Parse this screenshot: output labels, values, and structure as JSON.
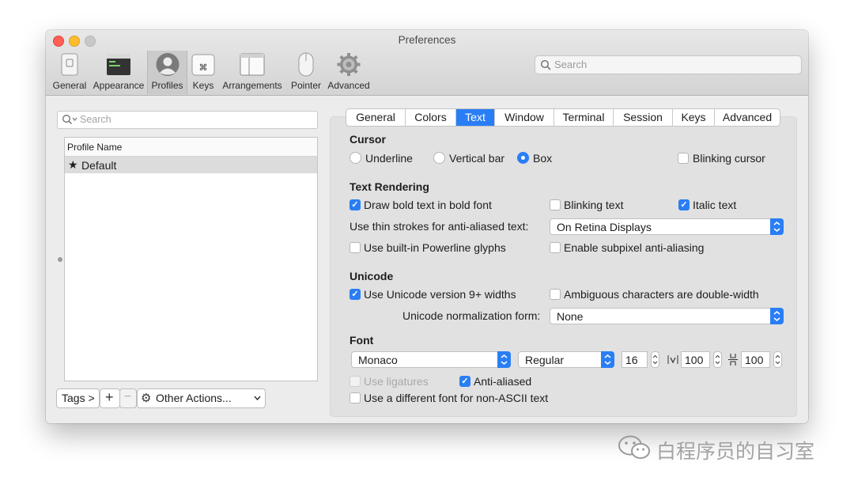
{
  "window": {
    "title": "Preferences"
  },
  "colors": {
    "accent": "#2a7ef5",
    "close": "#fe5f57",
    "minimize": "#febc2e",
    "zoom": "#c8c8c8"
  },
  "toolbar": {
    "items": [
      {
        "label": "General",
        "icon": "general-icon"
      },
      {
        "label": "Appearance",
        "icon": "appearance-icon"
      },
      {
        "label": "Profiles",
        "icon": "profiles-icon",
        "selected": true
      },
      {
        "label": "Keys",
        "icon": "keys-icon"
      },
      {
        "label": "Arrangements",
        "icon": "arrangements-icon"
      },
      {
        "label": "Pointer",
        "icon": "pointer-icon"
      },
      {
        "label": "Advanced",
        "icon": "advanced-gear-icon"
      }
    ],
    "search_placeholder": "Search"
  },
  "profiles": {
    "search_placeholder": "Search",
    "column_header": "Profile Name",
    "rows": [
      {
        "name": "Default",
        "default": true
      }
    ],
    "tags_button": "Tags >",
    "add_button": "+",
    "remove_button": "−",
    "other_actions": "Other Actions..."
  },
  "tabs": [
    {
      "label": "General"
    },
    {
      "label": "Colors"
    },
    {
      "label": "Text",
      "selected": true
    },
    {
      "label": "Window"
    },
    {
      "label": "Terminal"
    },
    {
      "label": "Session"
    },
    {
      "label": "Keys"
    },
    {
      "label": "Advanced"
    }
  ],
  "cursor": {
    "heading": "Cursor",
    "underline": "Underline",
    "vertical_bar": "Vertical bar",
    "box": "Box",
    "selected": "Box",
    "blinking_cursor": "Blinking cursor",
    "blinking_cursor_checked": false
  },
  "text_rendering": {
    "heading": "Text Rendering",
    "draw_bold": "Draw bold text in bold font",
    "draw_bold_checked": true,
    "blinking_text": "Blinking text",
    "blinking_text_checked": false,
    "italic_text": "Italic text",
    "italic_text_checked": true,
    "thin_strokes_label": "Use thin strokes for anti-aliased text:",
    "thin_strokes_value": "On Retina Displays",
    "powerline": "Use built-in Powerline glyphs",
    "powerline_checked": false,
    "subpixel": "Enable subpixel anti-aliasing",
    "subpixel_checked": false
  },
  "unicode": {
    "heading": "Unicode",
    "v9_widths": "Use Unicode version 9+ widths",
    "v9_widths_checked": true,
    "ambiguous": "Ambiguous characters are double-width",
    "ambiguous_checked": false,
    "normalization_label": "Unicode normalization form:",
    "normalization_value": "None"
  },
  "font": {
    "heading": "Font",
    "family": "Monaco",
    "weight": "Regular",
    "size": "16",
    "h_spacing": "100",
    "v_spacing": "100",
    "ligatures": "Use ligatures",
    "ligatures_checked": false,
    "anti_aliased": "Anti-aliased",
    "anti_aliased_checked": true,
    "non_ascii": "Use a different font for non-ASCII text",
    "non_ascii_checked": false
  },
  "watermark": {
    "text": "白程序员的自习室"
  }
}
